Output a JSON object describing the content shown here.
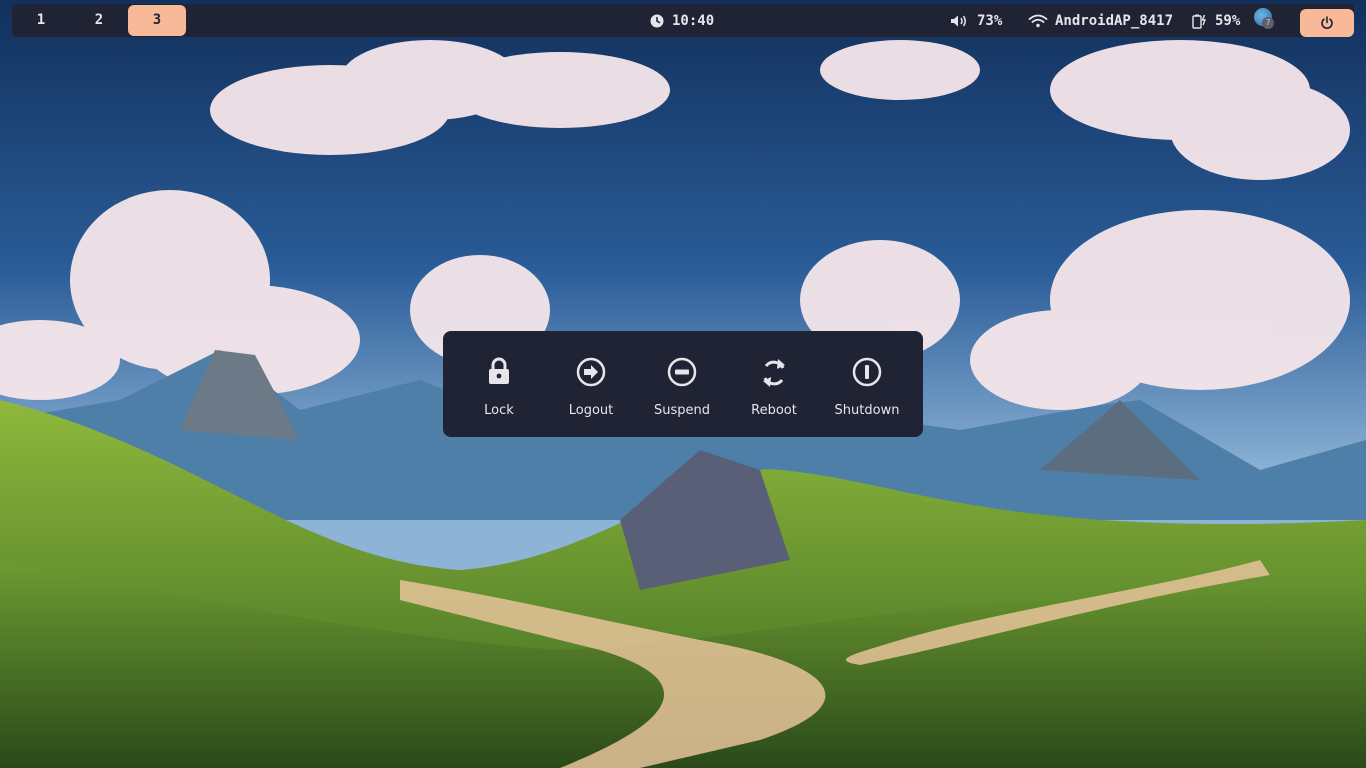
{
  "workspaces": [
    {
      "label": "1",
      "active": false
    },
    {
      "label": "2",
      "active": false
    },
    {
      "label": "3",
      "active": true
    }
  ],
  "clock": {
    "icon": "clock-icon",
    "time": "10:40"
  },
  "volume": {
    "icon": "volume-icon",
    "value": "73%"
  },
  "wifi": {
    "icon": "wifi-icon",
    "ssid": "AndroidAP_8417"
  },
  "battery": {
    "icon": "battery-charging-icon",
    "value": "59%"
  },
  "tray": {
    "icon": "avatar-icon",
    "badge": "7"
  },
  "power_button": {
    "icon": "power-icon"
  },
  "power_menu": {
    "items": [
      {
        "label": "Lock",
        "icon": "lock-icon"
      },
      {
        "label": "Logout",
        "icon": "logout-icon"
      },
      {
        "label": "Suspend",
        "icon": "suspend-icon"
      },
      {
        "label": "Reboot",
        "icon": "reboot-icon"
      },
      {
        "label": "Shutdown",
        "icon": "shutdown-icon"
      }
    ]
  },
  "colors": {
    "bar_bg": "#1f2333",
    "accent": "#f8b998",
    "text": "#e6e6ea"
  }
}
